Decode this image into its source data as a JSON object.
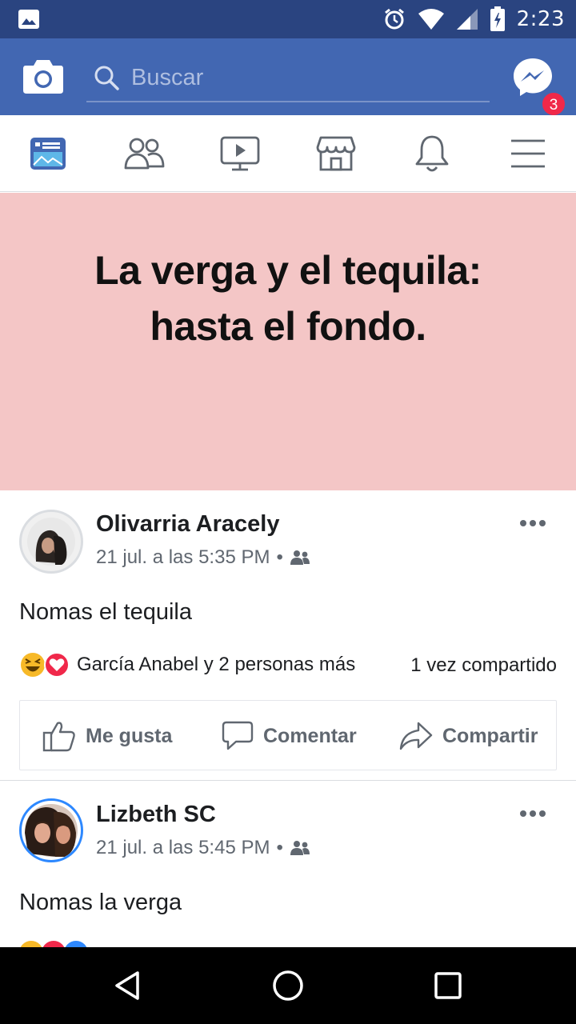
{
  "status_bar": {
    "time": "2:23",
    "icons": [
      "gallery-icon",
      "alarm-icon",
      "wifi-icon",
      "signal-icon",
      "battery-icon"
    ]
  },
  "header": {
    "search_placeholder": "Buscar",
    "messenger_badge": "3",
    "colors": {
      "bar": "#4267b2",
      "status": "#2a4480",
      "badge": "#f02849"
    }
  },
  "tabs": [
    {
      "name": "news-feed",
      "icon": "news-feed-icon",
      "active": true
    },
    {
      "name": "friends",
      "icon": "friends-icon"
    },
    {
      "name": "watch",
      "icon": "video-icon"
    },
    {
      "name": "marketplace",
      "icon": "store-icon"
    },
    {
      "name": "notifications",
      "icon": "bell-icon"
    },
    {
      "name": "menu",
      "icon": "hamburger-icon"
    }
  ],
  "post": {
    "text_line1": "La verga y el tequila:",
    "text_line2": "hasta el fondo.",
    "background": "#f4c6c6"
  },
  "comments": [
    {
      "author": "Olivarria Aracely",
      "timestamp": "21 jul. a las 5:35 PM",
      "body": "Nomas el tequila",
      "reactions_label": "García Anabel y 2 personas más",
      "shares": "1 vez compartido",
      "actions": {
        "like": "Me gusta",
        "comment": "Comentar",
        "share": "Compartir"
      }
    },
    {
      "author": "Lizbeth SC",
      "timestamp": "21 jul. a las 5:45 PM",
      "body": "Nomas la verga"
    }
  ]
}
